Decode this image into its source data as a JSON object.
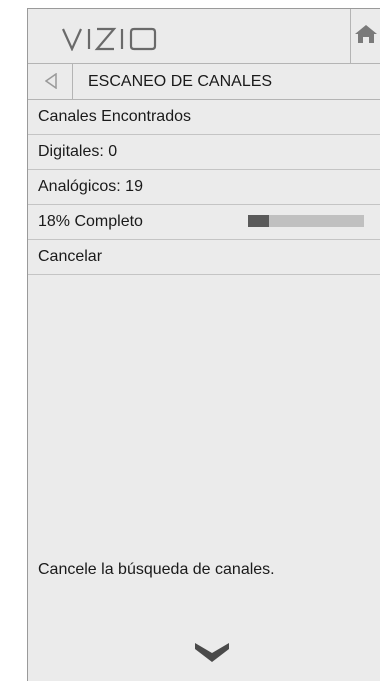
{
  "brand": {
    "logo_text": "VIZIO"
  },
  "header": {
    "home_icon": "home-icon"
  },
  "nav": {
    "back_icon": "back-arrow-icon",
    "title": "ESCANEO DE CANALES"
  },
  "menu": {
    "items": [
      {
        "label": "Canales Encontrados"
      },
      {
        "label": "Digitales: 0"
      },
      {
        "label": "Analógicos: 19"
      },
      {
        "label": "18% Completo",
        "progress": 0.18
      },
      {
        "label": "Cancelar"
      }
    ]
  },
  "help": {
    "text": "Cancele la búsqueda de canales."
  },
  "footer": {
    "scroll_icon": "chevron-down-icon"
  },
  "colors": {
    "panel_bg": "#ebebeb",
    "progress_fill": "#5a5a5a",
    "progress_track": "#c0c0c0"
  }
}
